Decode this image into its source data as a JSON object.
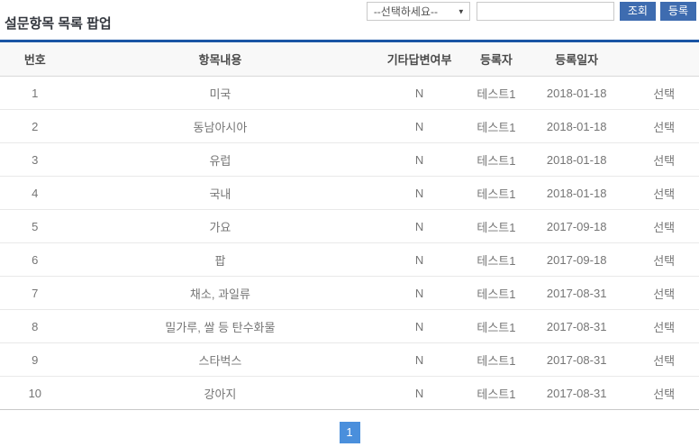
{
  "page": {
    "title": "설문항목 목록 팝업"
  },
  "toolbar": {
    "category_select": {
      "selected": "--선택하세요--",
      "arrow": "▼"
    },
    "keyword_input": {
      "value": "",
      "placeholder": ""
    },
    "search_button": "조회",
    "register_button": "등록"
  },
  "table": {
    "headers": {
      "no": "번호",
      "content": "항목내용",
      "other_answer": "기타답변여부",
      "writer": "등록자",
      "reg_date": "등록일자",
      "action": ""
    },
    "rows": [
      {
        "no": "1",
        "content": "미국",
        "other_answer": "N",
        "writer": "테스트1",
        "reg_date": "2018-01-18",
        "action": "선택"
      },
      {
        "no": "2",
        "content": "동남아시아",
        "other_answer": "N",
        "writer": "테스트1",
        "reg_date": "2018-01-18",
        "action": "선택"
      },
      {
        "no": "3",
        "content": "유럽",
        "other_answer": "N",
        "writer": "테스트1",
        "reg_date": "2018-01-18",
        "action": "선택"
      },
      {
        "no": "4",
        "content": "국내",
        "other_answer": "N",
        "writer": "테스트1",
        "reg_date": "2018-01-18",
        "action": "선택"
      },
      {
        "no": "5",
        "content": "가요",
        "other_answer": "N",
        "writer": "테스트1",
        "reg_date": "2017-09-18",
        "action": "선택"
      },
      {
        "no": "6",
        "content": "팝",
        "other_answer": "N",
        "writer": "테스트1",
        "reg_date": "2017-09-18",
        "action": "선택"
      },
      {
        "no": "7",
        "content": "채소, 과일류",
        "other_answer": "N",
        "writer": "테스트1",
        "reg_date": "2017-08-31",
        "action": "선택"
      },
      {
        "no": "8",
        "content": "밀가루, 쌀 등 탄수화물",
        "other_answer": "N",
        "writer": "테스트1",
        "reg_date": "2017-08-31",
        "action": "선택"
      },
      {
        "no": "9",
        "content": "스타벅스",
        "other_answer": "N",
        "writer": "테스트1",
        "reg_date": "2017-08-31",
        "action": "선택"
      },
      {
        "no": "10",
        "content": "강아지",
        "other_answer": "N",
        "writer": "테스트1",
        "reg_date": "2017-08-31",
        "action": "선택"
      }
    ]
  },
  "pagination": {
    "current_page": "1"
  },
  "colors": {
    "table_top_border": "#1a55a5",
    "button_blue": "#3e6cb0",
    "pagination_blue": "#4a8fdc"
  }
}
